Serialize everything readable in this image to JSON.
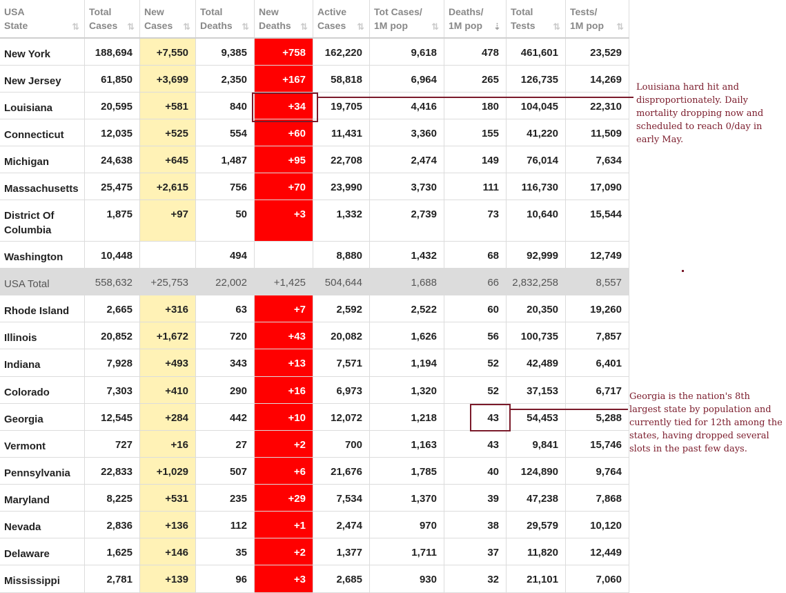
{
  "headers": [
    {
      "line1": "USA",
      "line2": "State"
    },
    {
      "line1": "Total",
      "line2": "Cases"
    },
    {
      "line1": "New",
      "line2": "Cases"
    },
    {
      "line1": "Total",
      "line2": "Deaths"
    },
    {
      "line1": "New",
      "line2": "Deaths"
    },
    {
      "line1": "Active",
      "line2": "Cases"
    },
    {
      "line1": "Tot Cases/",
      "line2": "1M pop"
    },
    {
      "line1": "Deaths/",
      "line2": "1M pop"
    },
    {
      "line1": "Total",
      "line2": "Tests"
    },
    {
      "line1": "Tests/",
      "line2": "1M pop"
    }
  ],
  "sort_icons": {
    "inactive": "⇅",
    "active": "⇣"
  },
  "rows": [
    [
      "New York",
      "188,694",
      "+7,550",
      "9,385",
      "+758",
      "162,220",
      "9,618",
      "478",
      "461,601",
      "23,529"
    ],
    [
      "New Jersey",
      "61,850",
      "+3,699",
      "2,350",
      "+167",
      "58,818",
      "6,964",
      "265",
      "126,735",
      "14,269"
    ],
    [
      "Louisiana",
      "20,595",
      "+581",
      "840",
      "+34",
      "19,705",
      "4,416",
      "180",
      "104,045",
      "22,310"
    ],
    [
      "Connecticut",
      "12,035",
      "+525",
      "554",
      "+60",
      "11,431",
      "3,360",
      "155",
      "41,220",
      "11,509"
    ],
    [
      "Michigan",
      "24,638",
      "+645",
      "1,487",
      "+95",
      "22,708",
      "2,474",
      "149",
      "76,014",
      "7,634"
    ],
    [
      "Massachusetts",
      "25,475",
      "+2,615",
      "756",
      "+70",
      "23,990",
      "3,730",
      "111",
      "116,730",
      "17,090"
    ],
    [
      "District Of Columbia",
      "1,875",
      "+97",
      "50",
      "+3",
      "1,332",
      "2,739",
      "73",
      "10,640",
      "15,544"
    ],
    [
      "Washington",
      "10,448",
      "",
      "494",
      "",
      "8,880",
      "1,432",
      "68",
      "92,999",
      "12,749"
    ],
    [
      "USA Total",
      "558,632",
      "+25,753",
      "22,002",
      "+1,425",
      "504,644",
      "1,688",
      "66",
      "2,832,258",
      "8,557"
    ],
    [
      "Rhode Island",
      "2,665",
      "+316",
      "63",
      "+7",
      "2,592",
      "2,522",
      "60",
      "20,350",
      "19,260"
    ],
    [
      "Illinois",
      "20,852",
      "+1,672",
      "720",
      "+43",
      "20,082",
      "1,626",
      "56",
      "100,735",
      "7,857"
    ],
    [
      "Indiana",
      "7,928",
      "+493",
      "343",
      "+13",
      "7,571",
      "1,194",
      "52",
      "42,489",
      "6,401"
    ],
    [
      "Colorado",
      "7,303",
      "+410",
      "290",
      "+16",
      "6,973",
      "1,320",
      "52",
      "37,153",
      "6,717"
    ],
    [
      "Georgia",
      "12,545",
      "+284",
      "442",
      "+10",
      "12,072",
      "1,218",
      "43",
      "54,453",
      "5,288"
    ],
    [
      "Vermont",
      "727",
      "+16",
      "27",
      "+2",
      "700",
      "1,163",
      "43",
      "9,841",
      "15,746"
    ],
    [
      "Pennsylvania",
      "22,833",
      "+1,029",
      "507",
      "+6",
      "21,676",
      "1,785",
      "40",
      "124,890",
      "9,764"
    ],
    [
      "Maryland",
      "8,225",
      "+531",
      "235",
      "+29",
      "7,534",
      "1,370",
      "39",
      "47,238",
      "7,868"
    ],
    [
      "Nevada",
      "2,836",
      "+136",
      "112",
      "+1",
      "2,474",
      "970",
      "38",
      "29,579",
      "10,120"
    ],
    [
      "Delaware",
      "1,625",
      "+146",
      "35",
      "+2",
      "1,377",
      "1,711",
      "37",
      "11,820",
      "12,449"
    ],
    [
      "Mississippi",
      "2,781",
      "+139",
      "96",
      "+3",
      "2,685",
      "930",
      "32",
      "21,101",
      "7,060"
    ]
  ],
  "colors": {
    "new_cases_bg": "#fff2b6",
    "new_deaths_bg": "#ff0000",
    "total_row_bg": "#dcdcdc",
    "annotation": "#7a1a2a"
  },
  "annotations": {
    "louisiana": "Louisiana hard hit and disproportionately.  Daily mortality dropping now and scheduled to reach 0/day in early May.",
    "georgia": "Georgia is the nation's 8th largest state by population and currently tied for 12th among the states, having dropped several slots in the past few days."
  }
}
